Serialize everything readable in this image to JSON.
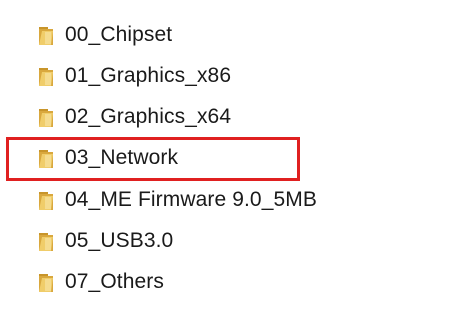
{
  "folders": [
    {
      "name": "00_Chipset",
      "icon": "folder-icon"
    },
    {
      "name": "01_Graphics_x86",
      "icon": "folder-icon"
    },
    {
      "name": "02_Graphics_x64",
      "icon": "folder-icon"
    },
    {
      "name": "03_Network",
      "icon": "folder-icon",
      "highlighted": true
    },
    {
      "name": "04_ME Firmware 9.0_5MB",
      "icon": "folder-icon"
    },
    {
      "name": "05_USB3.0",
      "icon": "folder-icon"
    },
    {
      "name": "07_Others",
      "icon": "folder-icon"
    }
  ],
  "highlight": {
    "color": "#e02020",
    "target": "03_Network"
  },
  "colors": {
    "folder_front": "#e8c15a",
    "folder_back": "#c8952a",
    "text": "#1a1a1a"
  }
}
